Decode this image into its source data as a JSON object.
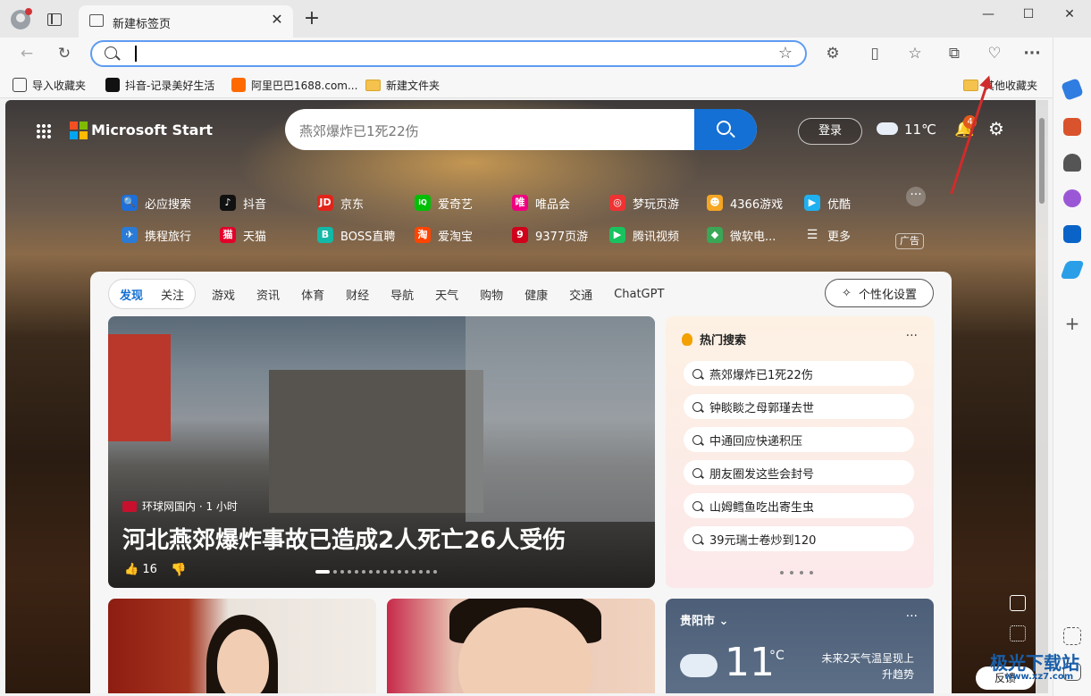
{
  "window": {
    "tab_title": "新建标签页",
    "tab_close": "✕",
    "new_tab": "+",
    "minimize": "—",
    "maximize": "☐",
    "close": "✕"
  },
  "toolbar": {
    "back": "←",
    "refresh": "↻",
    "address_value": "",
    "address_placeholder": "",
    "favorite_star": "☆",
    "menu_more": "···"
  },
  "bookmarks": [
    {
      "label": "导入收藏夹",
      "icon": "import-icon"
    },
    {
      "label": "抖音-记录美好生活",
      "icon": "douyin-icon"
    },
    {
      "label": "阿里巴巴1688.com...",
      "icon": "alibaba-icon"
    },
    {
      "label": "新建文件夹",
      "icon": "folder-icon"
    },
    {
      "label": "其他收藏夹",
      "icon": "folder-icon"
    }
  ],
  "ms_start": {
    "brand": "Microsoft Start",
    "search_text": "燕郊爆炸已1死22伤",
    "login": "登录",
    "temperature": "11℃",
    "notifications": "4"
  },
  "quicklinks": [
    {
      "label": "必应搜索",
      "color": "#1e6fd9",
      "glyph": "🔍"
    },
    {
      "label": "抖音",
      "color": "#111111",
      "glyph": "♪"
    },
    {
      "label": "京东",
      "color": "#e1251b",
      "glyph": "JD"
    },
    {
      "label": "爱奇艺",
      "color": "#00be06",
      "glyph": "iQ"
    },
    {
      "label": "唯品会",
      "color": "#f10180",
      "glyph": "唯"
    },
    {
      "label": "梦玩页游",
      "color": "#e33",
      "glyph": "◎"
    },
    {
      "label": "4366游戏",
      "color": "#f5a623",
      "glyph": "☻"
    },
    {
      "label": "优酷",
      "color": "#1fb0f0",
      "glyph": "▶"
    },
    {
      "label": "携程旅行",
      "color": "#2a7bd6",
      "glyph": "✈"
    },
    {
      "label": "天猫",
      "color": "#e4002b",
      "glyph": "猫"
    },
    {
      "label": "BOSS直聘",
      "color": "#14b8a6",
      "glyph": "B"
    },
    {
      "label": "爱淘宝",
      "color": "#ff4400",
      "glyph": "淘"
    },
    {
      "label": "9377页游",
      "color": "#d0021b",
      "glyph": "9"
    },
    {
      "label": "腾讯视频",
      "color": "#18c35f",
      "glyph": "▶"
    },
    {
      "label": "微软电...",
      "color": "#3aa757",
      "glyph": "◆"
    },
    {
      "label": "更多",
      "color": "transparent",
      "glyph": "☰"
    }
  ],
  "ad_label": "广告",
  "feed_tabs": {
    "discover": "发现",
    "follow": "关注",
    "items": [
      "游戏",
      "资讯",
      "体育",
      "财经",
      "导航",
      "天气",
      "购物",
      "健康",
      "交通",
      "ChatGPT"
    ],
    "personalize": "个性化设置"
  },
  "hero": {
    "source": "环球网国内 · 1 小时",
    "title": "河北燕郊爆炸事故已造成2人死亡26人受伤",
    "likes": "16",
    "slide_count": 16,
    "active_slide": 0
  },
  "hot_search": {
    "title": "热门搜索",
    "items": [
      "燕郊爆炸已1死22伤",
      "钟睒睒之母郭瑾去世",
      "中通回应快递积压",
      "朋友圈发这些会封号",
      "山姆鳕鱼吃出寄生虫",
      "39元瑞士卷炒到120"
    ]
  },
  "weather": {
    "city": "贵阳市",
    "temp": "11",
    "unit": "°C",
    "note": "未来2天气温呈现上升趋势"
  },
  "feedback": "反馈",
  "watermark": {
    "main": "极光下载站",
    "sub": "www.xz7.com"
  },
  "accent_color": "#1470d4"
}
